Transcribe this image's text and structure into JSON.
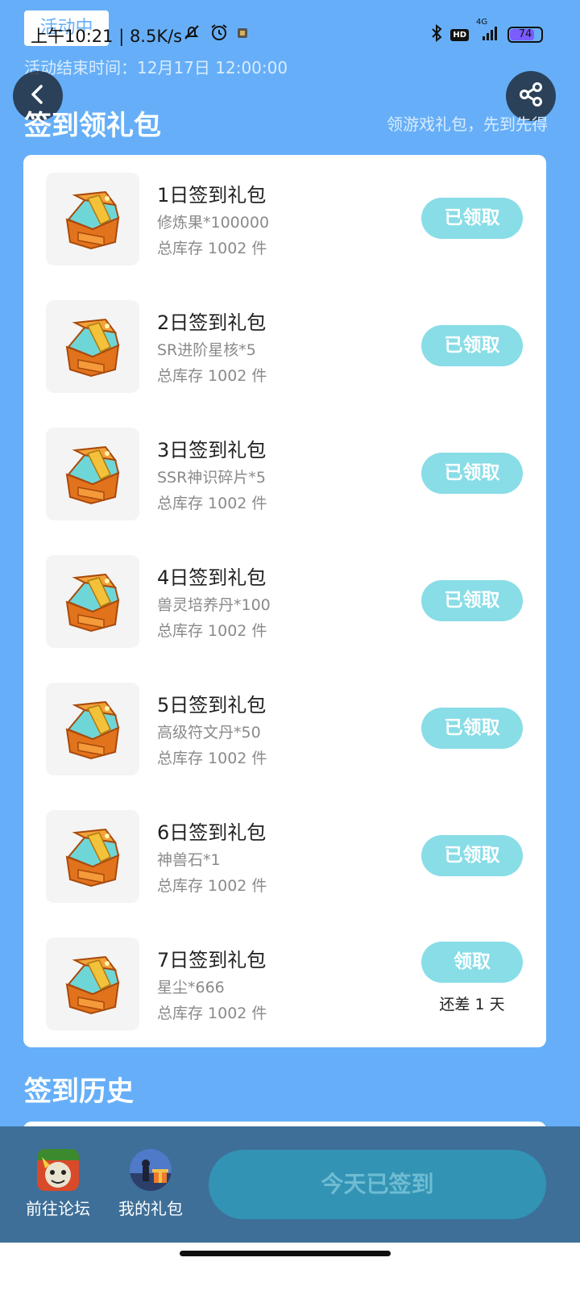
{
  "status_bar": {
    "activity_badge": "活动中",
    "time_speed": "上午10:21 | 8.5K/s",
    "network": "4G",
    "battery": "74",
    "hd": "HD"
  },
  "header": {
    "end_time": "活动结束时间：12月17日 12:00:00",
    "section_title": "签到领礼包",
    "slogan": "领游戏礼包，先到先得",
    "back_icon": "chevron-left-icon",
    "share_icon": "share-icon"
  },
  "gifts": [
    {
      "name": "1日签到礼包",
      "desc": "修炼果*100000",
      "stock": "总库存 1002 件",
      "button": "已领取"
    },
    {
      "name": "2日签到礼包",
      "desc": "SR进阶星核*5",
      "stock": "总库存 1002 件",
      "button": "已领取"
    },
    {
      "name": "3日签到礼包",
      "desc": "SSR神识碎片*5",
      "stock": "总库存 1002 件",
      "button": "已领取"
    },
    {
      "name": "4日签到礼包",
      "desc": "兽灵培养丹*100",
      "stock": "总库存 1002 件",
      "button": "已领取"
    },
    {
      "name": "5日签到礼包",
      "desc": "高级符文丹*50",
      "stock": "总库存 1002 件",
      "button": "已领取"
    },
    {
      "name": "6日签到礼包",
      "desc": "神兽石*1",
      "stock": "总库存 1002 件",
      "button": "已领取"
    },
    {
      "name": "7日签到礼包",
      "desc": "星尘*666",
      "stock": "总库存 1002 件",
      "button": "领取",
      "note": "还差 1 天"
    }
  ],
  "history": {
    "title": "签到历史"
  },
  "bottom_bar": {
    "forum_label": "前往论坛",
    "gifts_label": "我的礼包",
    "signed_button": "今天已签到"
  },
  "colors": {
    "background": "#66aff8",
    "claim_button": "#88dde7",
    "bottom_bar": "#3e6f98",
    "signed_button": "#3393b4"
  }
}
